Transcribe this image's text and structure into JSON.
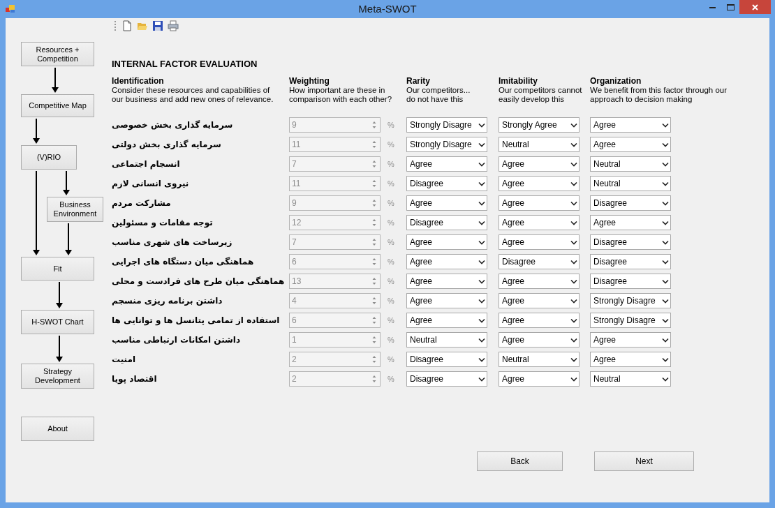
{
  "window": {
    "title": "Meta-SWOT"
  },
  "sidebar": {
    "steps": [
      {
        "label": "Resources + Competition",
        "kind": "step"
      },
      {
        "label": "Competitive Map",
        "kind": "step"
      },
      {
        "label": "(V)RIO",
        "kind": "step"
      },
      {
        "label": "Business Environment",
        "kind": "branch"
      },
      {
        "label": "Fit",
        "kind": "step"
      },
      {
        "label": "H-SWOT Chart",
        "kind": "step"
      },
      {
        "label": "Strategy Development",
        "kind": "step"
      },
      {
        "label": "About",
        "kind": "extra"
      }
    ]
  },
  "heading": "INTERNAL FACTOR EVALUATION",
  "columns": [
    {
      "title": "Identification",
      "description": "Consider these resources and capabilities of our business and add new ones of relevance."
    },
    {
      "title": "Weighting",
      "description": "How important are these in comparison with each other?"
    },
    {
      "title": "Rarity",
      "description": "Our competitors... do not have this"
    },
    {
      "title": "Imitability",
      "description": "Our competitors cannot easily develop this"
    },
    {
      "title": "Organization",
      "description": "We benefit from this factor through our approach to decision making"
    }
  ],
  "rows": [
    {
      "factor": "سرمایه گذاری بخش خصوصی",
      "weight": "9",
      "weight_disabled": true,
      "unit": "%",
      "rarity": "Strongly Disagre",
      "imitability": "Strongly Agree",
      "organization": "Agree"
    },
    {
      "factor": "سرمایه گذاری بخش دولتی",
      "weight": "11",
      "weight_disabled": true,
      "unit": "%",
      "rarity": "Strongly Disagre",
      "imitability": "Neutral",
      "organization": "Agree"
    },
    {
      "factor": "انسجام اجتماعی",
      "weight": "7",
      "weight_disabled": true,
      "unit": "%",
      "rarity": "Agree",
      "imitability": "Agree",
      "organization": "Neutral"
    },
    {
      "factor": "نیروی انسانی لازم",
      "weight": "11",
      "weight_disabled": true,
      "unit": "%",
      "rarity": "Disagree",
      "imitability": "Agree",
      "organization": "Neutral"
    },
    {
      "factor": "مشارکت مردم",
      "weight": "9",
      "weight_disabled": true,
      "unit": "%",
      "rarity": "Agree",
      "imitability": "Agree",
      "organization": "Disagree"
    },
    {
      "factor": "توجه مقامات و مسئولین",
      "weight": "12",
      "weight_disabled": true,
      "unit": "%",
      "rarity": "Disagree",
      "imitability": "Agree",
      "organization": "Agree"
    },
    {
      "factor": "زیرساخت های شهری مناسب",
      "weight": "7",
      "weight_disabled": true,
      "unit": "%",
      "rarity": "Agree",
      "imitability": "Agree",
      "organization": "Disagree"
    },
    {
      "factor": "هماهنگی میان دستگاه های اجرایی",
      "weight": "6",
      "weight_disabled": true,
      "unit": "%",
      "rarity": "Agree",
      "imitability": "Disagree",
      "organization": "Disagree"
    },
    {
      "factor": "هماهنگی میان طرح های فرادست و محلی",
      "weight": "13",
      "weight_disabled": true,
      "unit": "%",
      "rarity": "Agree",
      "imitability": "Agree",
      "organization": "Disagree"
    },
    {
      "factor": "داشتن برنامه ریزی منسجم",
      "weight": "4",
      "weight_disabled": true,
      "unit": "%",
      "rarity": "Agree",
      "imitability": "Agree",
      "organization": "Strongly Disagre"
    },
    {
      "factor": "استفاده از تمامی پتانسل ها و توانایی ها",
      "weight": "6",
      "weight_disabled": true,
      "unit": "%",
      "rarity": "Agree",
      "imitability": "Agree",
      "organization": "Strongly Disagre"
    },
    {
      "factor": "داشتن امکانات ارتباطی مناسب",
      "weight": "1",
      "weight_disabled": true,
      "unit": "%",
      "rarity": "Neutral",
      "imitability": "Agree",
      "organization": "Agree"
    },
    {
      "factor": "امنیت",
      "weight": "2",
      "weight_disabled": true,
      "unit": "%",
      "rarity": "Disagree",
      "imitability": "Neutral",
      "organization": "Agree"
    },
    {
      "factor": "اقتصاد پویا",
      "weight": "2",
      "weight_disabled": true,
      "unit": "%",
      "rarity": "Disagree",
      "imitability": "Agree",
      "organization": "Neutral"
    }
  ],
  "buttons": [
    {
      "label": "Back"
    },
    {
      "label": "Next"
    }
  ]
}
